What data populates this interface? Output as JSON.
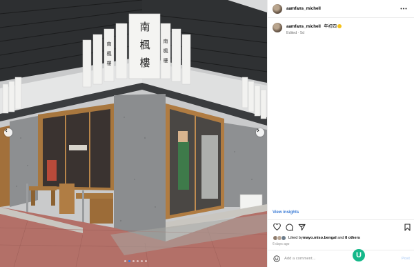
{
  "photo": {
    "sign_main": [
      "南",
      "楓",
      "樓"
    ],
    "sign_side_left": [
      "南",
      "楓",
      "樓"
    ],
    "sign_side_right": [
      "南",
      "楓",
      "樓"
    ],
    "carousel": {
      "count": 6,
      "active": 1
    }
  },
  "post": {
    "username": "aamfans_michell",
    "caption_user": "aamfans_michell",
    "caption_text": "年初四",
    "caption_meta": "Edited · 5d",
    "view_insights": "View insights",
    "likes_prefix": "Liked by ",
    "likes_user": "mayo.miso.bengal",
    "likes_middle": " and ",
    "likes_others": "8 others",
    "ago": "6 days ago",
    "comment_placeholder": "Add a comment...",
    "post_label": "Post"
  },
  "badge": {
    "letter": "U",
    "color": "#15b88a"
  },
  "colors": {
    "link": "#3a7bd5",
    "muted": "#737373",
    "post_disabled": "#bdd6f7"
  }
}
